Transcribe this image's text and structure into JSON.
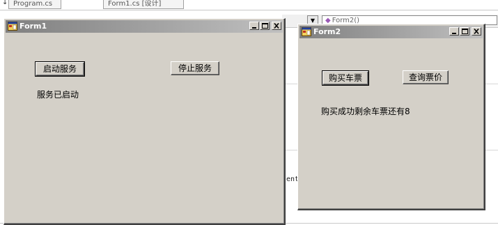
{
  "ide": {
    "tab1": "Program.cs",
    "tab2": "Form1.cs [设计]",
    "member_combo": "Form2()",
    "code_fragment": "ent"
  },
  "form1": {
    "title": "Form1",
    "start_button": "启动服务",
    "stop_button": "停止服务",
    "status_label": "服务已启动"
  },
  "form2": {
    "title": "Form2",
    "buy_button": "购买车票",
    "query_button": "查询票价",
    "result_label": "购买成功剩余车票还有8"
  }
}
